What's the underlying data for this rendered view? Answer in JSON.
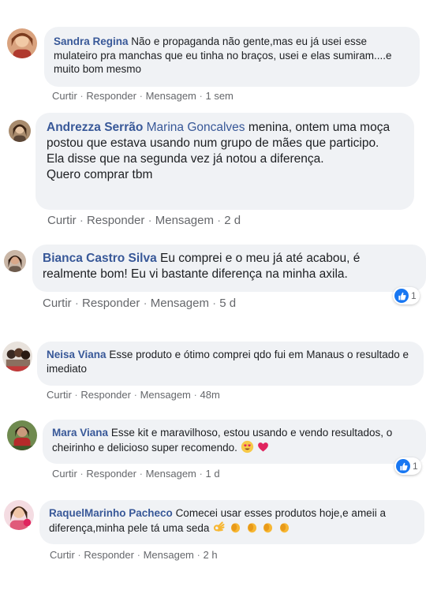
{
  "action_labels": {
    "like": "Curtir",
    "reply": "Responder",
    "message": "Mensagem",
    "separator": "·"
  },
  "comments": [
    {
      "author": "Sandra Regina",
      "text": "Não e propaganda não gente,mas eu já usei esse mulateiro pra manchas que eu tinha no braços, usei e elas sumiram....e muito bom mesmo",
      "time": "1 sem"
    },
    {
      "author": "Andrezza Serrão",
      "mention": "Marina Goncalves",
      "text": "menina, ontem uma moça postou que estava usando num grupo de mães que participo.",
      "text2": "Ela disse que na segunda vez já notou a diferença.",
      "text3": "Quero comprar tbm",
      "time": "2 d"
    },
    {
      "author": "Bianca Castro Silva",
      "text": "Eu comprei e o meu já até acabou, é realmente bom! Eu vi bastante diferença na minha axila.",
      "time": "5 d",
      "reaction_count": "1"
    },
    {
      "author": "Neisa Viana",
      "text": "Esse produto e ótimo comprei qdo fui em Manaus o resultado e imediato",
      "time": "48m"
    },
    {
      "author": "Mara Viana",
      "text": "Esse kit e maravilhoso, estou usando e vendo resultados, o cheirinho e delicioso super recomendo.",
      "time": "1 d",
      "reaction_count": "1"
    },
    {
      "author": "RaquelMarinho Pacheco",
      "text": "Comecei usar esses produtos hoje,e ameii a diferença,minha pele tá uma seda",
      "time": "2 h"
    }
  ],
  "colors": {
    "author": "#385898",
    "bubble": "#f0f2f5",
    "like_blue": "#1877f2"
  }
}
